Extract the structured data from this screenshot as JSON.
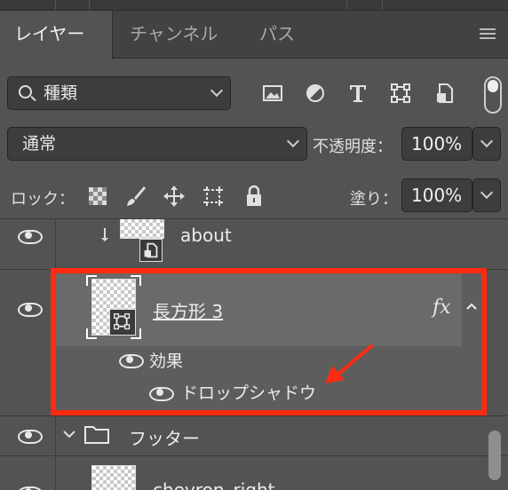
{
  "tabs": [
    {
      "label": "レイヤー",
      "active": true
    },
    {
      "label": "チャンネル",
      "active": false
    },
    {
      "label": "パス",
      "active": false
    }
  ],
  "filter": {
    "kind_label": "種類"
  },
  "blend": {
    "mode": "通常",
    "opacity_label": "不透明度：",
    "opacity_value": "100%"
  },
  "lock": {
    "label": "ロック：",
    "fill_label": "塗り：",
    "fill_value": "100%"
  },
  "layers": {
    "about": {
      "name": "about"
    },
    "rect3": {
      "name": "長方形 3",
      "fx": "fx"
    },
    "effects_label": "効果",
    "drop_shadow": "ドロップシャドウ",
    "footer": {
      "name": "フッター"
    },
    "chevron": {
      "name": "chevron_right"
    }
  },
  "colors": {
    "highlight": "#ff2a12",
    "panel_bg": "#535353",
    "selected_row": "#6a6a6a"
  }
}
